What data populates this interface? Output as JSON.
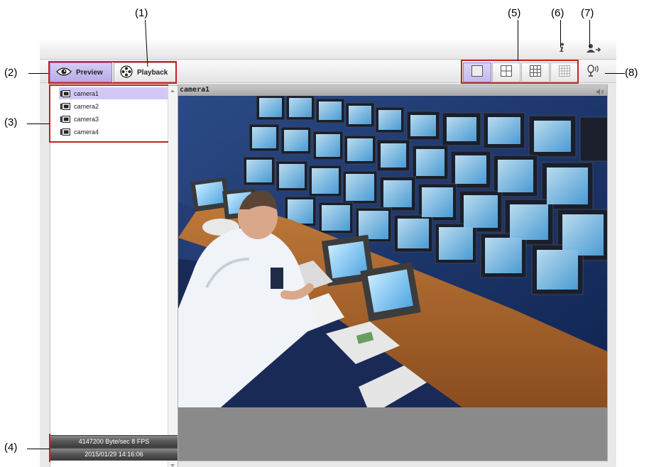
{
  "tabs": [
    {
      "label": "Preview",
      "active": true
    },
    {
      "label": "Playback",
      "active": false
    }
  ],
  "cameras": [
    {
      "name": "camera1",
      "selected": true
    },
    {
      "name": "camera2",
      "selected": false
    },
    {
      "name": "camera3",
      "selected": false
    },
    {
      "name": "camera4",
      "selected": false
    }
  ],
  "layouts": [
    "1x1",
    "2x2",
    "3x3",
    "4x4"
  ],
  "status": {
    "bitrate": "4147200 Byte/sec  8 FPS",
    "datetime": "2015/01/29 14:16:06"
  },
  "video": {
    "title": "camera1"
  },
  "callouts": [
    "(1)",
    "(2)",
    "(3)",
    "(4)",
    "(5)",
    "(6)",
    "(7)",
    "(8)"
  ],
  "colors": {
    "accent": "#c6b8ee",
    "callout_frame": "#c92020"
  },
  "icons": {
    "preview": "eye-icon",
    "playback": "film-reel-icon",
    "info": "info-icon",
    "logout": "logout-icon",
    "talk": "microphone-icon",
    "audio": "speaker-icon"
  }
}
